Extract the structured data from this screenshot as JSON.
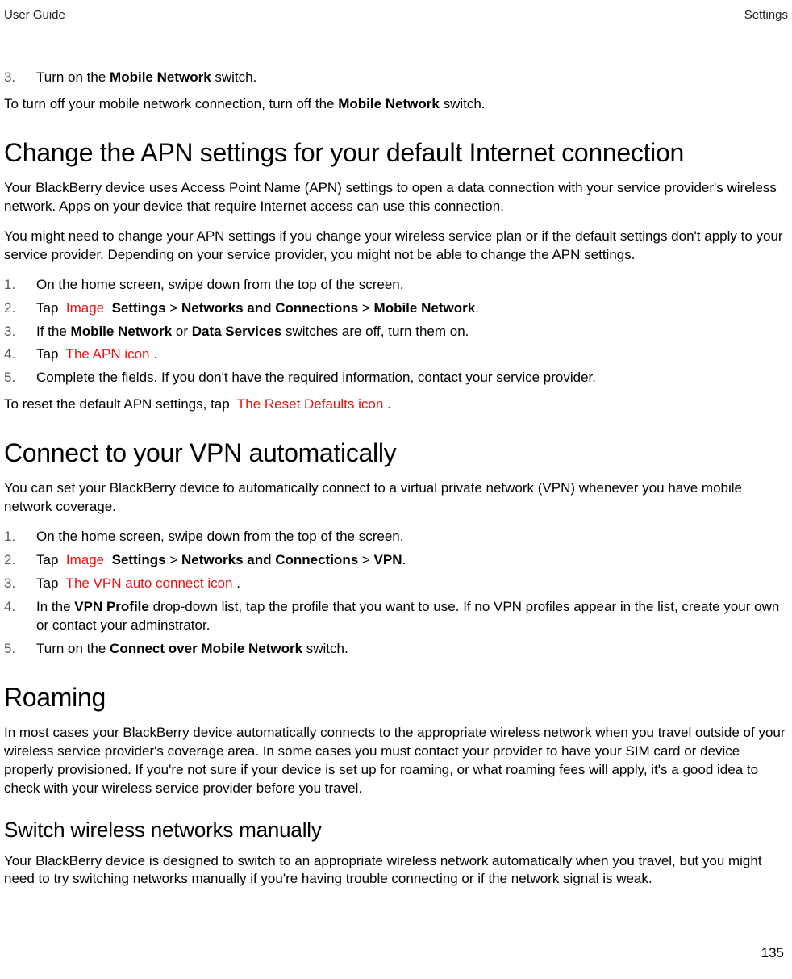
{
  "header": {
    "left": "User Guide",
    "right": "Settings"
  },
  "sec_a": {
    "items": [
      {
        "n": "3.",
        "pre": "Turn on the ",
        "b1": "Mobile Network",
        "post": " switch."
      }
    ],
    "p1_pre": "To turn off your mobile network connection, turn off the ",
    "p1_b": "Mobile Network",
    "p1_post": " switch."
  },
  "sec_b": {
    "title": "Change the APN settings for your default Internet connection",
    "p1": "Your BlackBerry device uses Access Point Name (APN) settings to open a data connection with your service provider's wireless network. Apps on your device that require Internet access can use this connection.",
    "p2": "You might need to change your APN settings if you change your wireless service plan or if the default settings don't apply to your service provider. Depending on your service provider, you might not be able to change the APN settings.",
    "steps": {
      "s1": {
        "n": "1.",
        "t": "On the home screen, swipe down from the top of the screen."
      },
      "s2": {
        "n": "2.",
        "pre": "Tap ",
        "img": " Image ",
        "b1": " Settings",
        "sep1": " > ",
        "b2": "Networks and Connections",
        "sep2": " > ",
        "b3": "Mobile Network",
        "post": "."
      },
      "s3": {
        "n": "3.",
        "pre": "If the ",
        "b1": "Mobile Network",
        "mid": " or ",
        "b2": "Data Services",
        "post": " switches are off, turn them on."
      },
      "s4": {
        "n": "4.",
        "pre": "Tap ",
        "img": " The APN icon ",
        "post": "."
      },
      "s5": {
        "n": "5.",
        "t": "Complete the fields. If you don't have the required information, contact your service provider."
      }
    },
    "p3_pre": "To reset the default APN settings, tap ",
    "p3_img": " The Reset Defaults icon ",
    "p3_post": "."
  },
  "sec_c": {
    "title": "Connect to your VPN automatically",
    "p1": "You can set your BlackBerry device to automatically connect to a virtual private network (VPN) whenever you have mobile network coverage.",
    "steps": {
      "s1": {
        "n": "1.",
        "t": "On the home screen, swipe down from the top of the screen."
      },
      "s2": {
        "n": "2.",
        "pre": "Tap ",
        "img": " Image ",
        "b1": " Settings",
        "sep1": " > ",
        "b2": "Networks and Connections",
        "sep2": " > ",
        "b3": "VPN",
        "post": "."
      },
      "s3": {
        "n": "3.",
        "pre": "Tap ",
        "img": " The VPN auto connect icon ",
        "post": "."
      },
      "s4": {
        "n": "4.",
        "pre": "In the ",
        "b1": "VPN Profile",
        "post": " drop-down list, tap the profile that you want to use. If no VPN profiles appear in the list, create your own or contact your adminstrator."
      },
      "s5": {
        "n": "5.",
        "pre": "Turn on the ",
        "b1": "Connect over Mobile Network",
        "post": " switch."
      }
    }
  },
  "sec_d": {
    "title": "Roaming",
    "p1": "In most cases your BlackBerry device automatically connects to the appropriate wireless network when you travel outside of your wireless service provider's coverage area. In some cases you must contact your provider to have your SIM card or device properly provisioned. If you're not sure if your device is set up for roaming, or what roaming fees will apply, it's a good idea to check with your wireless service provider before you travel."
  },
  "sec_e": {
    "title": "Switch wireless networks manually",
    "p1": "Your BlackBerry device is designed to switch to an appropriate wireless network automatically when you travel, but you might need to try switching networks manually if you're having trouble connecting or if the network signal is weak."
  },
  "page_number": "135"
}
